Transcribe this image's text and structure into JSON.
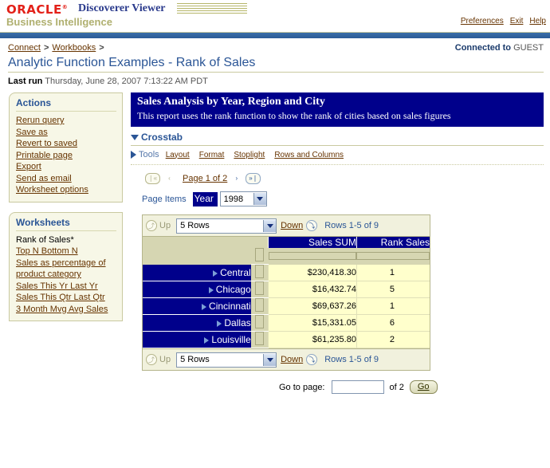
{
  "brand": {
    "logo": "ORACLE",
    "trademark": "®",
    "product": "Discoverer Viewer",
    "subtitle": "Business Intelligence",
    "links": [
      {
        "label": "Preferences"
      },
      {
        "label": "Exit"
      },
      {
        "label": "Help"
      }
    ]
  },
  "breadcrumb": {
    "items": [
      {
        "label": "Connect"
      },
      {
        "label": "Workbooks"
      }
    ],
    "separator": ">"
  },
  "connection": {
    "prefix": "Connected to",
    "user": "GUEST"
  },
  "page": {
    "title": "Analytic Function Examples - Rank of Sales",
    "lastrun_label": "Last run",
    "lastrun_value": "Thursday, June 28, 2007 7:13:22 AM PDT"
  },
  "sidebar": {
    "actions": {
      "title": "Actions",
      "items": [
        {
          "label": "Rerun query"
        },
        {
          "label": "Save as"
        },
        {
          "label": "Revert to saved"
        },
        {
          "label": "Printable page"
        },
        {
          "label": "Export"
        },
        {
          "label": "Send as email"
        },
        {
          "label": "Worksheet options"
        }
      ]
    },
    "worksheets": {
      "title": "Worksheets",
      "current": "Rank of Sales*",
      "items": [
        {
          "label": "Top N Bottom N"
        },
        {
          "label": "Sales as percentage of product category"
        },
        {
          "label": "Sales This Yr Last Yr"
        },
        {
          "label": "Sales This Qtr Last Qtr"
        },
        {
          "label": "3 Month Mvg Avg Sales"
        }
      ]
    }
  },
  "report": {
    "banner_title": "Sales Analysis by Year, Region and City",
    "banner_subtitle": "This report uses the rank function to show the rank of cities based on sales figures",
    "section_label": "Crosstab",
    "tools_label": "Tools",
    "tools_links": [
      {
        "label": "Layout"
      },
      {
        "label": "Format"
      },
      {
        "label": "Stoplight"
      },
      {
        "label": "Rows and Columns"
      }
    ]
  },
  "pager": {
    "first_icon": "first-page-icon",
    "prev_icon": "previous-page-icon",
    "label": "Page 1 of 2",
    "next_icon": "next-page-icon",
    "last_icon": "last-page-icon",
    "first_glyph": "❘«",
    "prev_glyph": "‹",
    "next_glyph": "›",
    "last_glyph": "»❘"
  },
  "page_items": {
    "label": "Page Items",
    "dimension": "Year",
    "value": "1998",
    "options": [
      "1998"
    ]
  },
  "rows_bar": {
    "up_glyph": "⤴",
    "up_label": "Up",
    "rows_value": "5 Rows",
    "rows_options": [
      "5 Rows"
    ],
    "down_label": "Down",
    "down_glyph": "⤵",
    "count": "Rows 1-5 of 9"
  },
  "crosstab": {
    "column_headers": [
      "Sales SUM",
      "Rank Sales"
    ],
    "rows": [
      {
        "label": "Central",
        "sales": "$230,418.30",
        "rank": "1"
      },
      {
        "label": "Chicago",
        "sales": "$16,432.74",
        "rank": "5"
      },
      {
        "label": "Cincinnati",
        "sales": "$69,637.26",
        "rank": "1"
      },
      {
        "label": "Dallas",
        "sales": "$15,331.05",
        "rank": "6"
      },
      {
        "label": "Louisville",
        "sales": "$61,235.80",
        "rank": "2"
      }
    ]
  },
  "goto": {
    "label": "Go to page:",
    "value": "",
    "placeholder": "",
    "of_label": "of 2",
    "button": "Go"
  },
  "colors": {
    "oracle_red": "#e32119",
    "brand_blue": "#2a3a8c",
    "navy": "#00008b",
    "link_brown": "#663300",
    "title_blue": "#2a5596",
    "khaki": "#d6d6b2",
    "cell_yellow": "#ffffcc",
    "panel_bg": "#f7f7e7"
  }
}
